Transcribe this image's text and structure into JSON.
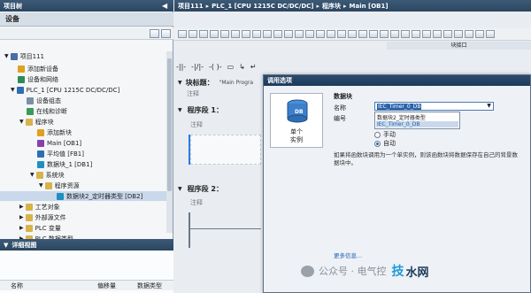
{
  "left_panel": {
    "title": "项目树",
    "devices_header": "设备",
    "tree": [
      {
        "label": "项目111",
        "icon": "project-icon",
        "color": "#4a6fa5"
      },
      {
        "label": "添加新设备",
        "icon": "add-device-icon",
        "color": "#e0a020"
      },
      {
        "label": "设备和网络",
        "icon": "network-icon",
        "color": "#2e8b57"
      },
      {
        "label": "PLC_1 [CPU 1215C DC/DC/DC]",
        "icon": "plc-icon",
        "color": "#2f6db5"
      },
      {
        "label": "设备组态",
        "icon": "device-config-icon",
        "color": "#7b8fa5"
      },
      {
        "label": "在线和诊断",
        "icon": "diagnostics-icon",
        "color": "#3a9a5a"
      },
      {
        "label": "程序块",
        "icon": "folder-icon",
        "color": "#d8b24a"
      },
      {
        "label": "添加新块",
        "icon": "add-block-icon",
        "color": "#e0a020"
      },
      {
        "label": "Main [OB1]",
        "icon": "ob-icon",
        "color": "#8a3fb0"
      },
      {
        "label": "平均值 [FB1]",
        "icon": "fb-icon",
        "color": "#2f6db5"
      },
      {
        "label": "数据块_1 [DB1]",
        "icon": "db-icon",
        "color": "#1f8fbf"
      },
      {
        "label": "系统块",
        "icon": "folder-icon",
        "color": "#d8b24a"
      },
      {
        "label": "程序资源",
        "icon": "folder-icon",
        "color": "#d8b24a"
      },
      {
        "label": "数据块2_定时器类型 [DB2]",
        "icon": "db-icon",
        "color": "#1f8fbf"
      },
      {
        "label": "工艺对象",
        "icon": "folder-icon",
        "color": "#d8b24a"
      },
      {
        "label": "外部源文件",
        "icon": "folder-icon",
        "color": "#d8b24a"
      },
      {
        "label": "PLC 变量",
        "icon": "folder-icon",
        "color": "#d8b24a"
      },
      {
        "label": "PLC 数据类型",
        "icon": "folder-icon",
        "color": "#d8b24a"
      }
    ],
    "detail_title": "详细视图",
    "detail_columns": [
      "名称",
      "偏移量",
      "数据类型"
    ]
  },
  "breadcrumb": [
    "项目111",
    "PLC_1 [CPU 1215C DC/DC/DC]",
    "程序块",
    "Main [OB1]"
  ],
  "sidebar_label": "块接口",
  "editor": {
    "block_title_label": "块标题：",
    "block_title_value": "\"Main Progra",
    "comment": "注释",
    "networks": [
      {
        "label": "程序段 1：",
        "comment": "注释"
      },
      {
        "label": "程序段 2：",
        "comment": "注释"
      }
    ]
  },
  "dialog": {
    "title": "调用选项",
    "icon_text": "DB",
    "type_label_1": "单个",
    "type_label_2": "实例",
    "section_title": "数据块",
    "name_label": "名称",
    "name_value": "IEC_Timer_0_DB",
    "number_label": "编号",
    "options": [
      "数据块2_定时器类型",
      "IEC_Timer_0_DB"
    ],
    "manual_label": "手动",
    "auto_label": "自动",
    "description": "如果将函数块调用为一个单实例，则该函数块将数据保存在自己的背景数据块中。",
    "more_info": "更多信息..."
  },
  "watermark": "公众号 · 电气控",
  "watermark_logo": "技",
  "watermark_extra": "水网",
  "colors": {
    "title_bar": "#2b4660",
    "dialog_title": "#1d3b5c",
    "selection": "#c9d8ea",
    "link": "#1a5fb4"
  }
}
